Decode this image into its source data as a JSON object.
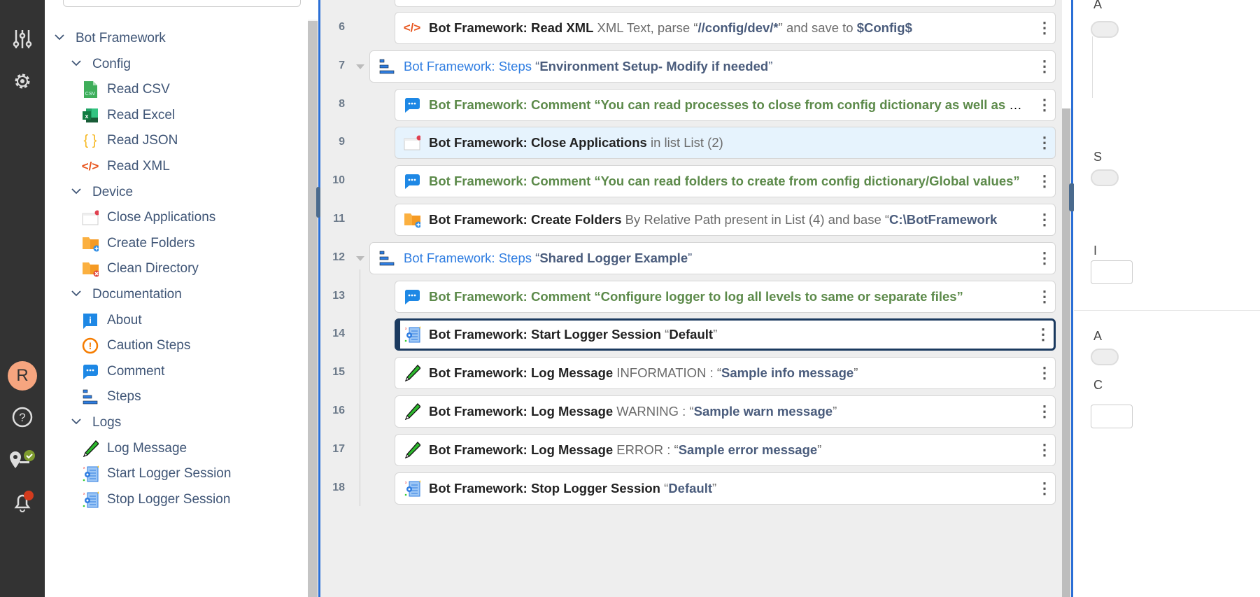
{
  "rail": {
    "avatar_initial": "R",
    "icons": [
      "sliders-icon",
      "gear-icon",
      "help-icon",
      "bot-agent-icon",
      "bell-icon"
    ]
  },
  "palette": {
    "root": "Bot Framework",
    "groups": [
      {
        "label": "Config",
        "items": [
          {
            "label": "Read CSV",
            "icon": "csv-file-icon"
          },
          {
            "label": "Read Excel",
            "icon": "excel-icon"
          },
          {
            "label": "Read JSON",
            "icon": "json-braces-icon"
          },
          {
            "label": "Read XML",
            "icon": "xml-code-icon"
          }
        ]
      },
      {
        "label": "Device",
        "items": [
          {
            "label": "Close Applications",
            "icon": "close-window-icon"
          },
          {
            "label": "Create Folders",
            "icon": "folder-add-icon"
          },
          {
            "label": "Clean Directory",
            "icon": "folder-clean-icon"
          }
        ]
      },
      {
        "label": "Documentation",
        "items": [
          {
            "label": "About",
            "icon": "info-icon"
          },
          {
            "label": "Caution Steps",
            "icon": "caution-icon"
          },
          {
            "label": "Comment",
            "icon": "comment-icon"
          },
          {
            "label": "Steps",
            "icon": "steps-icon"
          }
        ]
      },
      {
        "label": "Logs",
        "items": [
          {
            "label": "Log Message",
            "icon": "pencil-icon"
          },
          {
            "label": "Start Logger Session",
            "icon": "logger-icon"
          },
          {
            "label": "Stop Logger Session",
            "icon": "logger-icon"
          }
        ]
      }
    ]
  },
  "flow": {
    "rows": [
      {
        "n": "6",
        "icon": "xml-code-icon",
        "kind": "action",
        "parts": [
          {
            "t": "Bot Framework: Read XML",
            "s": "action"
          },
          {
            "t": " XML Text, parse “",
            "s": "plain"
          },
          {
            "t": "//config/dev/*",
            "s": "value"
          },
          {
            "t": "” and save to ",
            "s": "plain"
          },
          {
            "t": "$Config$",
            "s": "value"
          }
        ]
      },
      {
        "n": "7",
        "icon": "steps-icon",
        "kind": "steps",
        "parts": [
          {
            "t": "Bot Framework: Steps",
            "s": "steps"
          },
          {
            "t": " “",
            "s": "svalue"
          },
          {
            "t": "Environment Setup- Modify if needed",
            "s": "value"
          },
          {
            "t": "”",
            "s": "svalue"
          }
        ]
      },
      {
        "n": "8",
        "icon": "comment-icon",
        "kind": "action",
        "parts": [
          {
            "t": "Bot Framework: Comment “You can read processes to close from config dictionary as well as Global values”",
            "s": "comment"
          }
        ]
      },
      {
        "n": "9",
        "icon": "close-window-icon",
        "kind": "selected",
        "parts": [
          {
            "t": "Bot Framework: Close Applications",
            "s": "action"
          },
          {
            "t": " in list List (2)",
            "s": "plain"
          }
        ]
      },
      {
        "n": "10",
        "icon": "comment-icon",
        "kind": "action",
        "parts": [
          {
            "t": "Bot Framework: Comment “You can read folders to create from config dictionary/Global values”",
            "s": "comment"
          }
        ]
      },
      {
        "n": "11",
        "icon": "folder-add-icon",
        "kind": "action",
        "parts": [
          {
            "t": "Bot Framework: Create Folders",
            "s": "action"
          },
          {
            "t": " By Relative Path present in List (4) and base “",
            "s": "plain"
          },
          {
            "t": "C:\\BotFramework",
            "s": "value"
          }
        ]
      },
      {
        "n": "12",
        "icon": "steps-icon",
        "kind": "steps",
        "parts": [
          {
            "t": "Bot Framework: Steps",
            "s": "steps"
          },
          {
            "t": " “",
            "s": "svalue"
          },
          {
            "t": "Shared Logger Example",
            "s": "value"
          },
          {
            "t": "”",
            "s": "svalue"
          }
        ]
      },
      {
        "n": "13",
        "icon": "comment-icon",
        "kind": "action",
        "parts": [
          {
            "t": "Bot Framework: Comment “Configure logger to log all levels to same or separate files”",
            "s": "comment"
          }
        ]
      },
      {
        "n": "14",
        "icon": "logger-icon",
        "kind": "focus",
        "parts": [
          {
            "t": "Bot Framework: Start Logger Session",
            "s": "action"
          },
          {
            "t": " “",
            "s": "plain"
          },
          {
            "t": "Default",
            "s": "action"
          },
          {
            "t": "”",
            "s": "plain"
          }
        ]
      },
      {
        "n": "15",
        "icon": "pencil-icon",
        "kind": "action",
        "parts": [
          {
            "t": "Bot Framework: Log Message",
            "s": "action"
          },
          {
            "t": " INFORMATION : “",
            "s": "plain"
          },
          {
            "t": "Sample info message",
            "s": "value"
          },
          {
            "t": "”",
            "s": "plain"
          }
        ]
      },
      {
        "n": "16",
        "icon": "pencil-icon",
        "kind": "action",
        "parts": [
          {
            "t": "Bot Framework: Log Message",
            "s": "action"
          },
          {
            "t": " WARNING : “",
            "s": "plain"
          },
          {
            "t": "Sample warn message",
            "s": "value"
          },
          {
            "t": "”",
            "s": "plain"
          }
        ]
      },
      {
        "n": "17",
        "icon": "pencil-icon",
        "kind": "action",
        "parts": [
          {
            "t": "Bot Framework: Log Message",
            "s": "action"
          },
          {
            "t": " ERROR : “",
            "s": "plain"
          },
          {
            "t": "Sample error message",
            "s": "value"
          },
          {
            "t": "”",
            "s": "plain"
          }
        ]
      },
      {
        "n": "18",
        "icon": "logger-icon",
        "kind": "action",
        "parts": [
          {
            "t": "Bot Framework: Stop Logger Session",
            "s": "action"
          },
          {
            "t": " “",
            "s": "plain"
          },
          {
            "t": "Default",
            "s": "value"
          },
          {
            "t": "”",
            "s": "plain"
          }
        ]
      }
    ]
  },
  "right_panel": {
    "labels": [
      "A",
      "S",
      "I",
      "A",
      "C"
    ]
  },
  "colors": {
    "rail": "#333333",
    "accent": "#2b6fd6",
    "canvas": "#eeeeee",
    "comment": "#5c8a4a",
    "steps": "#2f7de1"
  }
}
